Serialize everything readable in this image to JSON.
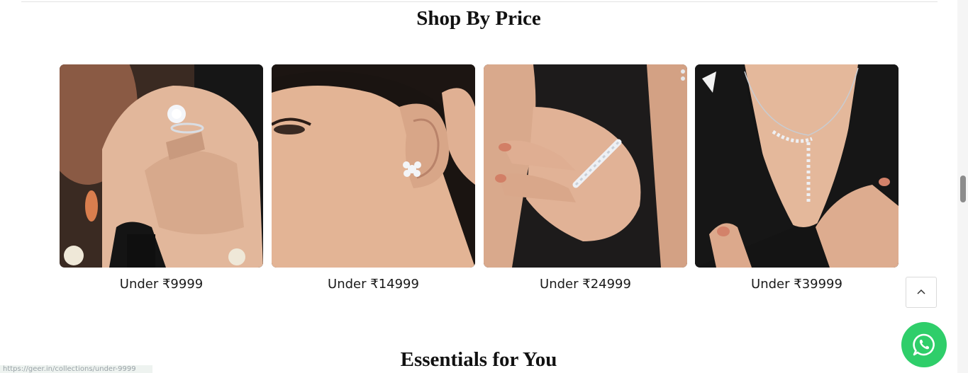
{
  "sections": {
    "shop_by_price": {
      "title": "Shop By Price",
      "cards": [
        {
          "label": "Under ₹9999",
          "image": "ring-on-hand-chess-piece"
        },
        {
          "label": "Under ₹14999",
          "image": "flower-stud-earring"
        },
        {
          "label": "Under ₹24999",
          "image": "band-ring-on-finger"
        },
        {
          "label": "Under ₹39999",
          "image": "drop-pendant-necklace"
        }
      ]
    },
    "essentials": {
      "title": "Essentials for You"
    }
  },
  "status_bar": {
    "url": "https://geer.in/collections/under-9999"
  },
  "widgets": {
    "scroll_to_top_icon": "chevron-up-icon",
    "chat_icon": "whatsapp-icon",
    "chat_color": "#2fce6a"
  }
}
